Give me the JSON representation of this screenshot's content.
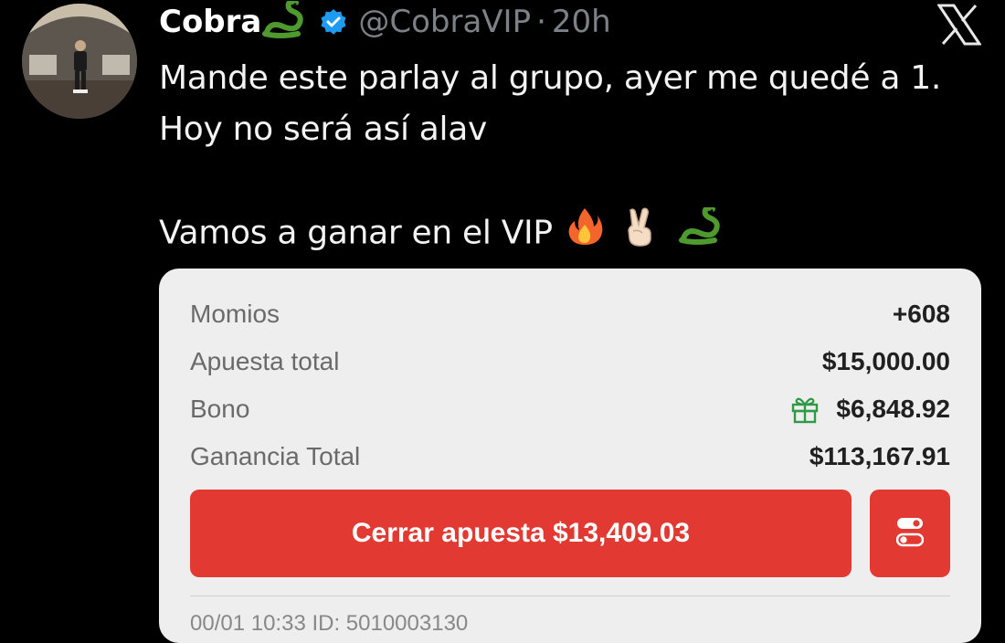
{
  "tweet": {
    "author": {
      "display_name": "Cobra",
      "display_emoji": "snake",
      "verified": true,
      "handle": "@CobraVIP",
      "separator": "·",
      "time": "20h"
    },
    "text_lines": [
      "Mande este parlay al grupo, ayer me quedé a 1.",
      "Hoy no será así alav",
      "Vamos a ganar en el VIP"
    ],
    "trailing_emojis": [
      "fire",
      "victory-hand",
      "snake"
    ]
  },
  "bet_card": {
    "rows": [
      {
        "label": "Momios",
        "value": "+608"
      },
      {
        "label": "Apuesta total",
        "value": "$15,000.00"
      },
      {
        "label": "Bono",
        "value": "$6,848.92",
        "icon": "gift-icon"
      },
      {
        "label": "Ganancia Total",
        "value": "$113,167.91"
      }
    ],
    "cashout_label": "Cerrar apuesta $13,409.03",
    "accent_color": "#e23a33",
    "footer_text": "00/01 10:33 ID: 5010003130"
  },
  "brand": {
    "logo": "x-logo"
  }
}
